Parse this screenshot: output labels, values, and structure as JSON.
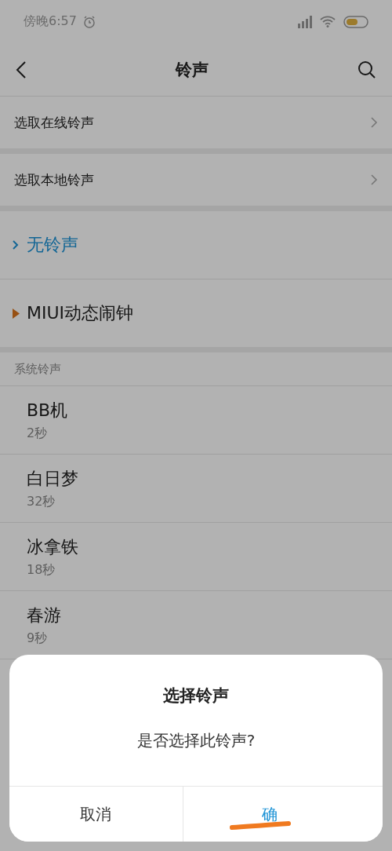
{
  "status_bar": {
    "time": "傍晚6:57"
  },
  "header": {
    "title": "铃声"
  },
  "sources": [
    {
      "label": "选取在线铃声"
    },
    {
      "label": "选取本地铃声"
    }
  ],
  "special": [
    {
      "kind": "option",
      "label": "无铃声",
      "selected": true
    },
    {
      "kind": "folder",
      "label": "MIUI动态闹钟",
      "selected": false
    }
  ],
  "system": {
    "heading": "系统铃声",
    "items": [
      {
        "name": "BB机",
        "duration": "2秒",
        "selected": false
      },
      {
        "name": "白日梦",
        "duration": "32秒",
        "selected": false
      },
      {
        "name": "冰拿铁",
        "duration": "18秒",
        "selected": false
      },
      {
        "name": "春游",
        "duration": "9秒",
        "selected": false
      }
    ]
  },
  "dialog": {
    "title": "选择铃声",
    "message": "是否选择此铃声?",
    "buttons": [
      {
        "label": "取消",
        "kind": "cancel"
      },
      {
        "label": "确",
        "kind": "confirm"
      }
    ]
  }
}
